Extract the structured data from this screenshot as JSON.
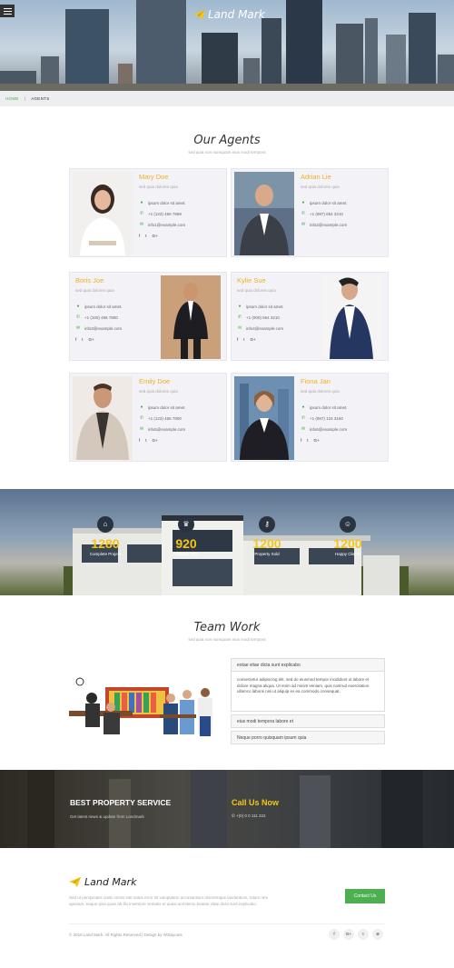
{
  "header": {
    "logo_text": "Land Mark",
    "menu_icon": "hamburger-icon",
    "logo_icon": "paper-plane-icon"
  },
  "breadcrumb": {
    "home": "HOME",
    "separator": "|",
    "current": "AGENTS"
  },
  "agents_section": {
    "title": "Our Agents",
    "subtitle": "sed quia non numquam eius modi tempora"
  },
  "agents": [
    {
      "name": "Mary Doe",
      "role": "sed quia dolores quia",
      "address": "ipsum dolor sit amet.",
      "phone": "+1 (123) 456 7869",
      "email": "info1@example.com"
    },
    {
      "name": "Adrian Lie",
      "role": "sed quia dolores quia",
      "address": "ipsum dolor sit amet.",
      "phone": "+1 (987) 654 3210",
      "email": "info2@example.com"
    },
    {
      "name": "Boris Joe",
      "role": "sed quia dolores quia",
      "address": "ipsum dolor sit amet.",
      "phone": "+1 (100) 456 7800",
      "email": "info3@example.com"
    },
    {
      "name": "Kylie Sue",
      "role": "sed quia dolores quia",
      "address": "ipsum dolor sit amet.",
      "phone": "+1 (000) 654 3210",
      "email": "info4@example.com"
    },
    {
      "name": "Emily Doe",
      "role": "sed quia dolores quia",
      "address": "ipsum dolor sit amet.",
      "phone": "+1 (123) 456 7800",
      "email": "info5@example.com"
    },
    {
      "name": "Fiona Jan",
      "role": "sed quia dolores quia",
      "address": "ipsum dolor sit amet.",
      "phone": "+1 (987) 124 3150",
      "email": "info6@example.com"
    }
  ],
  "social_icons": {
    "facebook": "f",
    "twitter": "t",
    "google": "G+"
  },
  "counters": [
    {
      "value": "1280",
      "label": "Complete Project",
      "icon": "home-icon"
    },
    {
      "value": "920",
      "label": "Awards Win",
      "icon": "trophy-icon"
    },
    {
      "value": "1200",
      "label": "Property Sold",
      "icon": "key-icon"
    },
    {
      "value": "1200",
      "label": "Happy Clients",
      "icon": "smile-icon"
    }
  ],
  "team_section": {
    "title": "Team Work",
    "subtitle": "sed quia non numquam eius modi tempora"
  },
  "accordion": [
    {
      "title": "eotae vitae dicta sunt explicabo",
      "body": "consectetur adipiscing elit, sed do eiusmod tempor incididunt ut labore et dolore magna aliqua. Ut enim ad minim veniam, quis nostrud exercitation ullamco laboris nisi ut aliquip ex ea commodo consequat."
    },
    {
      "title": "eius modi tempora labore et"
    },
    {
      "title": "Neque porro quisquam ipsum quia"
    }
  ],
  "property": {
    "title": "BEST PROPERTY SERVICE",
    "subtitle": "Get latest news & update from Landmark",
    "call_title": "Call Us Now",
    "phone": "+(0) 0 0 111 222"
  },
  "footer": {
    "logo_text": "Land Mark",
    "description": "Sed ut perspiciatis unde omnis iste natus error sit voluptatem accusantium doloremque laudantium, totam rem aperiam, eaque ipsa quae ab illo inventore veritatis et quasi architecto beatae vitae dicta sunt explicabo.",
    "contact_button": "Contact Us",
    "copyright": "© 2018 Land Mark. All Rights Reserved | Design by W3layouts",
    "social": [
      "f",
      "G+",
      "t",
      "⊛"
    ]
  }
}
